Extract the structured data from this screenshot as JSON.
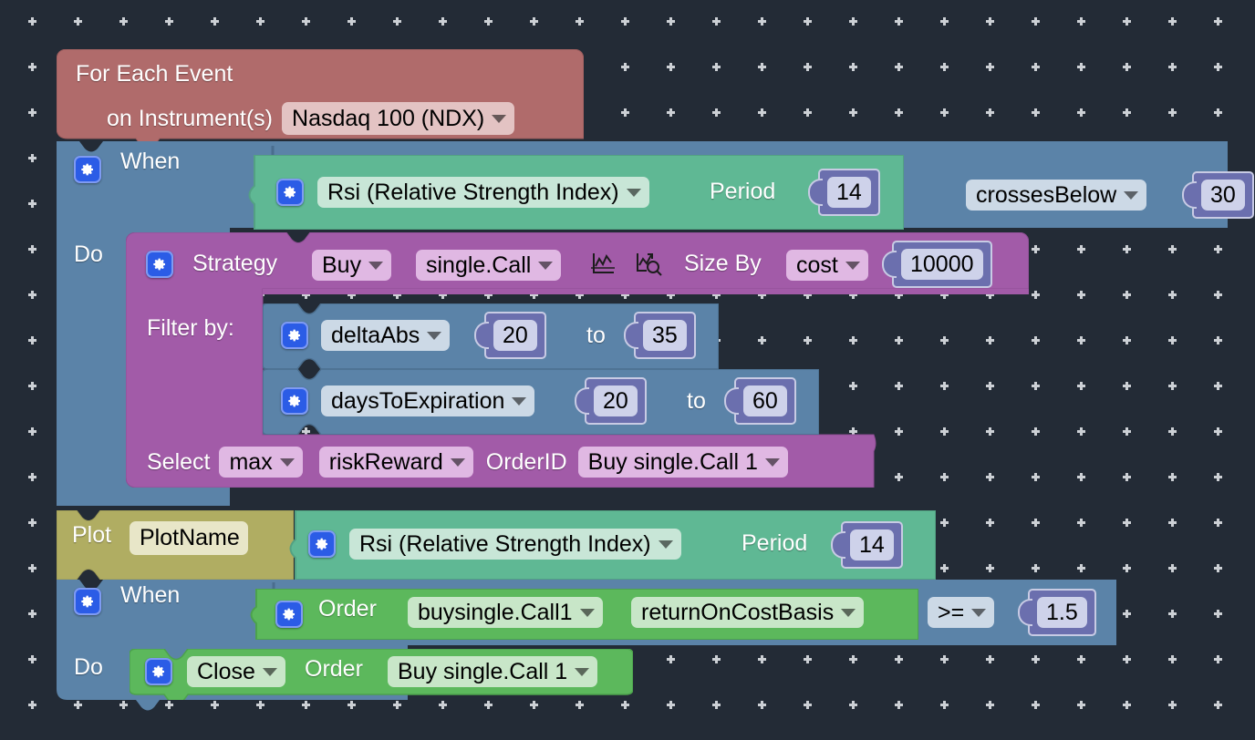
{
  "canvas": {
    "background": "#232b36",
    "grid_marker": "plus-cross"
  },
  "blocks": {
    "for_each_event": {
      "color": "#b06b6b",
      "title": "For Each Event",
      "instrument_label": "on Instrument(s)",
      "instrument_value": "Nasdaq 100 (NDX)"
    },
    "when_rsi": {
      "color": "#5b83a8",
      "when_label": "When",
      "indicator_color": "#5fb894",
      "indicator_value": "Rsi (Relative Strength Index)",
      "period_label": "Period",
      "period_value": "14",
      "operator_value": "crossesBelow",
      "threshold_value": "30"
    },
    "do_label": "Do",
    "strategy": {
      "color": "#a25ba8",
      "title": "Strategy",
      "action_value": "Buy",
      "instrument_value": "single.Call",
      "chart_icon": "chart-line-icon",
      "analyze_icon": "chart-search-icon",
      "size_by_label": "Size By",
      "size_by_value": "cost",
      "size_amount": "10000",
      "filter_label": "Filter by:",
      "filters": [
        {
          "field": "deltaAbs",
          "min": "20",
          "to": "to",
          "max": "35"
        },
        {
          "field": "daysToExpiration",
          "min": "20",
          "to": "to",
          "max": "60"
        }
      ],
      "select_label": "Select",
      "select_agg": "max",
      "select_metric": "riskReward",
      "orderid_label": "OrderID",
      "orderid_value": "Buy single.Call 1"
    },
    "plot": {
      "color": "#b0ad62",
      "label": "Plot",
      "name_value": "PlotName",
      "indicator_color": "#5fb894",
      "indicator_value": "Rsi (Relative Strength Index)",
      "period_label": "Period",
      "period_value": "14"
    },
    "when_order": {
      "color": "#5b83a8",
      "when_label": "When",
      "order_color": "#5cb85c",
      "order_label": "Order",
      "order_value": "buysingle.Call1",
      "metric_value": "returnOnCostBasis",
      "comparator_value": ">=",
      "comparator_threshold": "1.5"
    },
    "do_close": {
      "do_label": "Do",
      "color": "#5cb85c",
      "action_value": "Close",
      "order_label": "Order",
      "order_value": "Buy single.Call 1"
    }
  }
}
